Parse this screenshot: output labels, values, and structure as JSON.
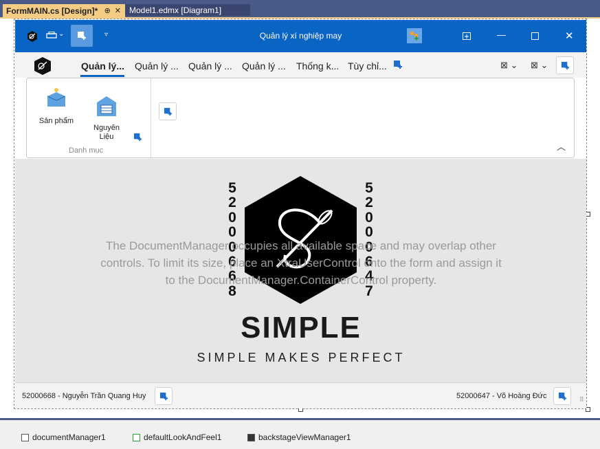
{
  "ide": {
    "tabs": [
      {
        "label": "FormMAIN.cs [Design]*",
        "active": true
      },
      {
        "label": "Model1.edmx [Diagram1]",
        "active": false
      }
    ]
  },
  "form": {
    "title": "Quản lý xí nghiệp may",
    "ribbon_tabs": [
      "Quản lý...",
      "Quản lý ...",
      "Quản lý ...",
      "Quản lý ...",
      "Thống k...",
      "Tùy chỉ..."
    ],
    "group": {
      "label": "Danh mục",
      "buttons": [
        {
          "label": "Sản phẩm",
          "icon": "product-box-icon"
        },
        {
          "label": "Nguyên\nLiệu",
          "icon": "warehouse-icon"
        }
      ]
    },
    "document_manager_hint": "The DocumentManager occupies all available space and may overlap other controls. To limit its size, place an XtraUserControl onto the form and assign it to the DocumentManager.ContainerControl property.",
    "logo": {
      "word": "SIMPLE",
      "tagline": "SIMPLE MAKES PERFECT",
      "left_code": "52000668",
      "right_code": "52000647"
    },
    "status": {
      "left": "52000668 - Nguyễn Trần Quang Huy",
      "right": "52000647 - Võ Hoàng Đức"
    }
  },
  "tray": {
    "items": [
      "documentManager1",
      "defaultLookAndFeel1",
      "backstageViewManager1"
    ]
  },
  "colors": {
    "titlebar": "#0a64c4",
    "active_tab": "#f5cc84",
    "ide_chrome": "#4a5a87"
  }
}
